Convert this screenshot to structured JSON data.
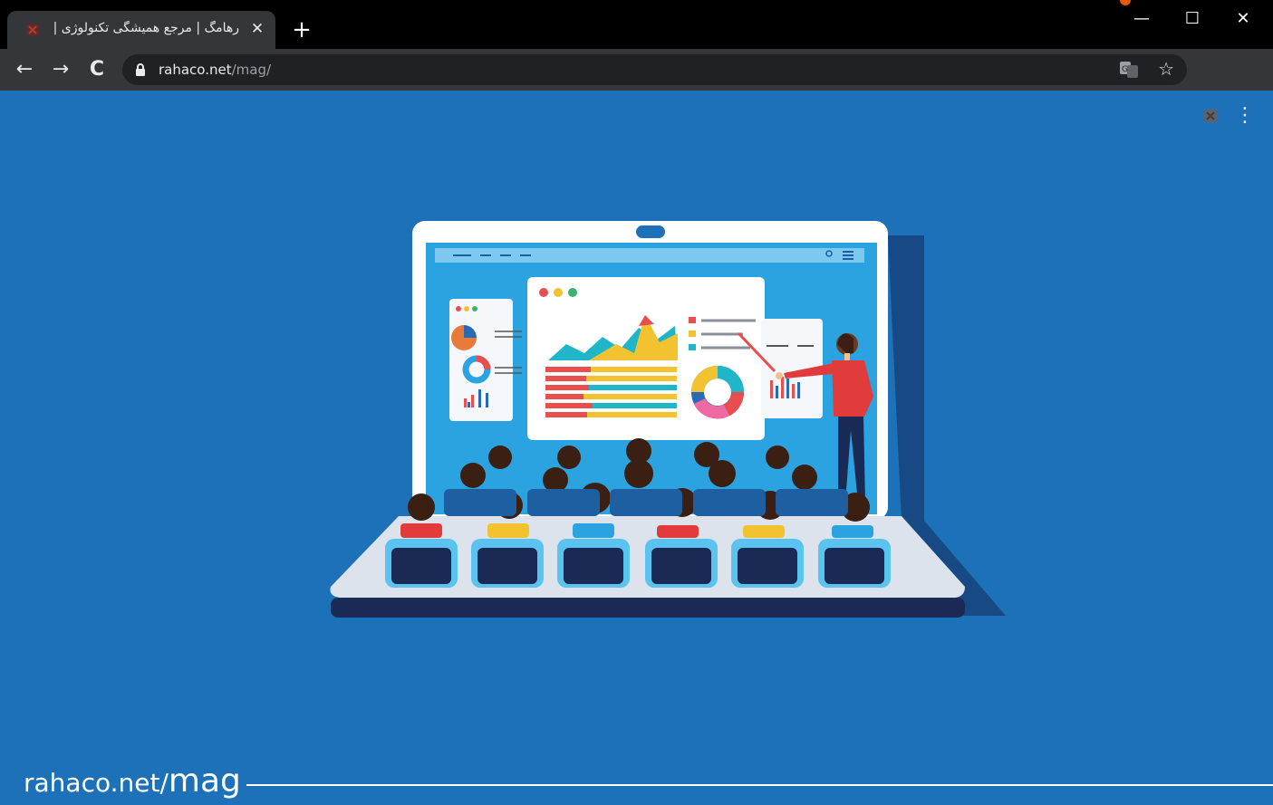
{
  "browser": {
    "tab": {
      "title": "رهامگ | مرجع همیشگی تکنولوژی |",
      "close_label": "✕"
    },
    "new_tab_label": "+",
    "window_controls": {
      "minimize": "—",
      "maximize": "☐",
      "close": "✕"
    },
    "nav": {
      "back": "←",
      "forward": "→",
      "reload": "C"
    },
    "address": {
      "domain": "rahaco.net",
      "path": "/mag/"
    },
    "menu_label": "⋮",
    "icons": [
      "favicon",
      "lock-icon",
      "translate-icon",
      "star-icon",
      "extension-icon",
      "menu-icon"
    ]
  },
  "page": {
    "footer": {
      "domain": "rahaco.net/",
      "section": "mag"
    },
    "colors": {
      "background": "#1d71b8",
      "accent": "#e8590c"
    }
  }
}
